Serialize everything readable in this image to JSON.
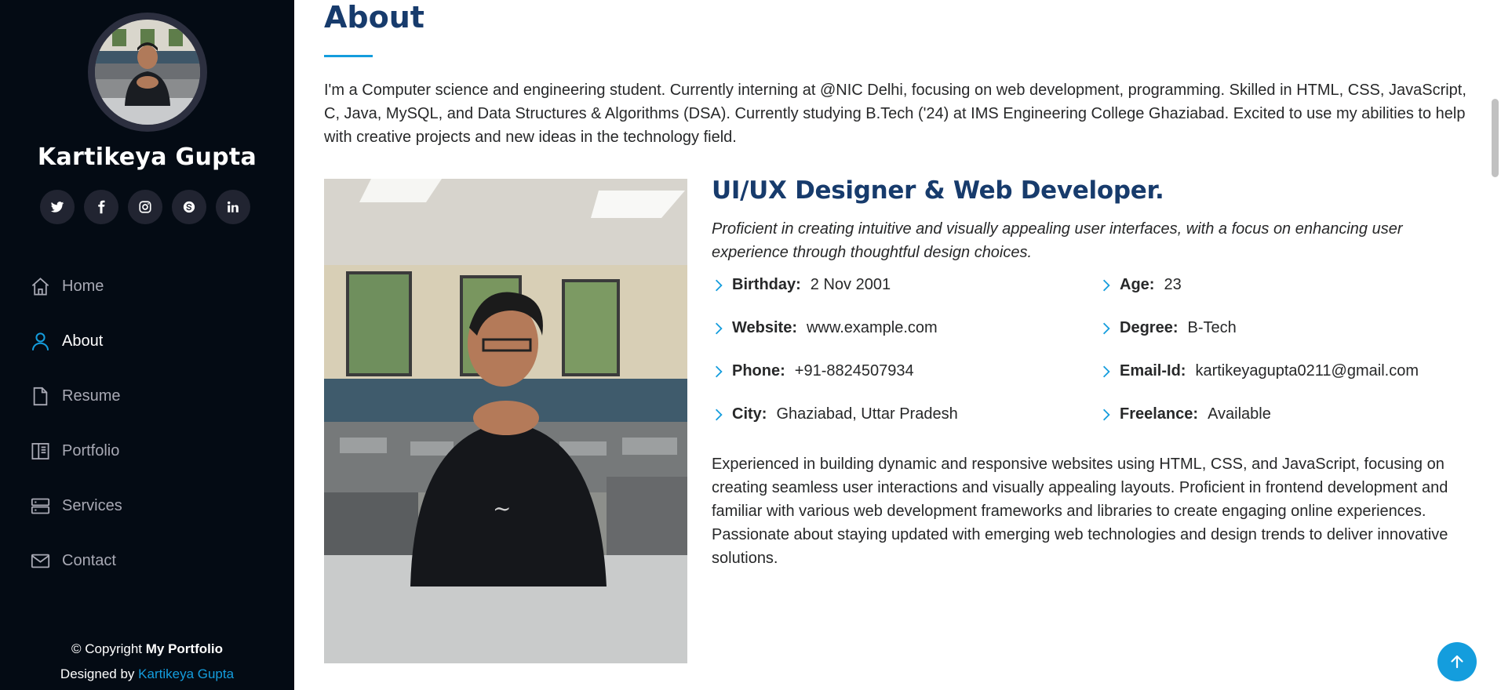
{
  "profile": {
    "name": "Kartikeya Gupta"
  },
  "social_icons": [
    "twitter-icon",
    "facebook-icon",
    "instagram-icon",
    "skype-icon",
    "linkedin-icon"
  ],
  "nav": {
    "items": [
      {
        "label": "Home",
        "icon": "home-icon",
        "active": false
      },
      {
        "label": "About",
        "icon": "person-icon",
        "active": true
      },
      {
        "label": "Resume",
        "icon": "file-icon",
        "active": false
      },
      {
        "label": "Portfolio",
        "icon": "book-icon",
        "active": false
      },
      {
        "label": "Services",
        "icon": "server-icon",
        "active": false
      },
      {
        "label": "Contact",
        "icon": "envelope-icon",
        "active": false
      }
    ]
  },
  "footer": {
    "copyright_prefix": "© Copyright ",
    "copyright_brand": "My Portfolio",
    "designed_by": "Designed by ",
    "credit": "Kartikeya Gupta"
  },
  "about": {
    "title": "About",
    "intro": "I'm a Computer science and engineering student. Currently interning at @NIC Delhi, focusing on web development, programming. Skilled in HTML, CSS, JavaScript, C, Java, MySQL, and Data Structures & Algorithms (DSA). Currently studying B.Tech ('24) at IMS Engineering College Ghaziabad. Excited to use my abilities to help with creative projects and new ideas in the technology field.",
    "role": "UI/UX Designer & Web Developer.",
    "tagline": "Proficient in creating intuitive and visually appealing user interfaces, with a focus on enhancing user experience through thoughtful design choices.",
    "info": {
      "birthday_label": "Birthday:",
      "birthday": "2 Nov 2001",
      "website_label": "Website:",
      "website": "www.example.com",
      "phone_label": "Phone:",
      "phone": "+91-8824507934",
      "city_label": "City:",
      "city": "Ghaziabad, Uttar Pradesh",
      "age_label": "Age:",
      "age": "23",
      "degree_label": "Degree:",
      "degree": "B-Tech",
      "email_label": "Email-Id:",
      "email": "kartikeyagupta0211@gmail.com",
      "freelance_label": "Freelance:",
      "freelance": "Available"
    },
    "summary": "Experienced in building dynamic and responsive websites using HTML, CSS, and JavaScript, focusing on creating seamless user interactions and visually appealing layouts. Proficient in frontend development and familiar with various web development frameworks and libraries to create engaging online experiences. Passionate about staying updated with emerging web technologies and design trends to deliver innovative solutions."
  },
  "colors": {
    "sidebar_bg": "#040b14",
    "accent": "#149ddd",
    "heading": "#173b6c"
  }
}
